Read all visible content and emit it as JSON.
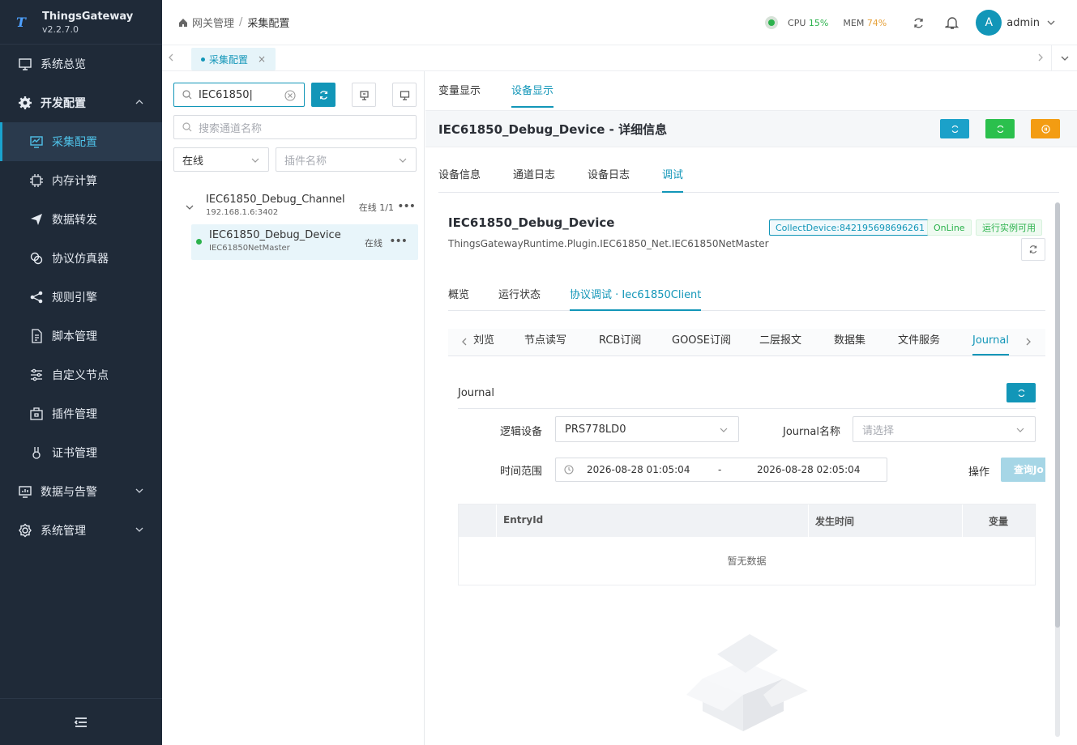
{
  "app": {
    "name": "ThingsGateway",
    "version": "v2.2.7.0",
    "logo_letter": "T"
  },
  "sidebar": {
    "items": [
      {
        "label": "系统总览",
        "icon": "monitor-icon"
      },
      {
        "label": "开发配置",
        "icon": "gear-icon"
      },
      {
        "label": "采集配置",
        "icon": "chart-monitor-icon"
      },
      {
        "label": "内存计算",
        "icon": "chip-icon"
      },
      {
        "label": "数据转发",
        "icon": "send-icon"
      },
      {
        "label": "协议仿真器",
        "icon": "link-icon"
      },
      {
        "label": "规则引擎",
        "icon": "share-icon"
      },
      {
        "label": "脚本管理",
        "icon": "document-icon"
      },
      {
        "label": "自定义节点",
        "icon": "sliders-icon"
      },
      {
        "label": "插件管理",
        "icon": "package-icon"
      },
      {
        "label": "证书管理",
        "icon": "certificate-icon"
      },
      {
        "label": "数据与告警",
        "icon": "alert-monitor-icon"
      },
      {
        "label": "系统管理",
        "icon": "settings-icon"
      }
    ]
  },
  "header": {
    "breadcrumb": [
      "网关管理",
      "采集配置"
    ],
    "cpu_label": "CPU",
    "cpu_value": "15%",
    "mem_label": "MEM",
    "mem_value": "74%",
    "avatar_letter": "A",
    "user": "admin"
  },
  "page_tab": {
    "label": "采集配置",
    "close": "×"
  },
  "left": {
    "search_value": "IEC61850",
    "channel_search_placeholder": "搜索通道名称",
    "status_filter": "在线",
    "plugin_placeholder": "插件名称",
    "channel": {
      "name": "IEC61850_Debug_Channel",
      "address": "192.168.1.6:3402",
      "status": "在线 1/1",
      "more": "•••"
    },
    "device": {
      "name": "IEC61850_Debug_Device",
      "plugin": "IEC61850NetMaster",
      "status": "在线",
      "more": "•••"
    }
  },
  "right": {
    "top_tabs": [
      "变量显示",
      "设备显示"
    ],
    "detail_title": "IEC61850_Debug_Device - 详细信息",
    "detail_tabs": [
      "设备信息",
      "通道日志",
      "设备日志",
      "调试"
    ],
    "device_name": "IEC61850_Debug_Device",
    "device_desc": "ThingsGatewayRuntime.Plugin.IEC61850_Net.IEC61850NetMaster",
    "tags": {
      "collect": "CollectDevice:842195698696261",
      "online": "OnLine",
      "runtime": "运行实例可用"
    },
    "sub_tabs": [
      "概览",
      "运行状态",
      "协议调试 · Iec61850Client"
    ],
    "proto_tabs": [
      "刘览",
      "节点读写",
      "RCB订阅",
      "GOOSE订阅",
      "二层报文",
      "数据集",
      "文件服务",
      "Journal"
    ],
    "journal": {
      "title": "Journal",
      "logic_device_label": "逻辑设备",
      "logic_device_value": "PRS778LD0",
      "journal_name_label": "Journal名称",
      "journal_name_placeholder": "请选择",
      "time_range_label": "时间范围",
      "time_start": "2026-08-28 01:05:04",
      "time_sep": "-",
      "time_end": "2026-08-28 02:05:04",
      "action_label": "操作",
      "query_button": "查询Jo"
    },
    "table": {
      "columns": [
        "EntryId",
        "发生时间",
        "变量"
      ],
      "empty_text": "暂无数据"
    }
  },
  "colors": {
    "accent": "#1296b8",
    "sidebar_bg": "#1f2a38",
    "green": "#2bb24c",
    "orange": "#f39c12"
  }
}
